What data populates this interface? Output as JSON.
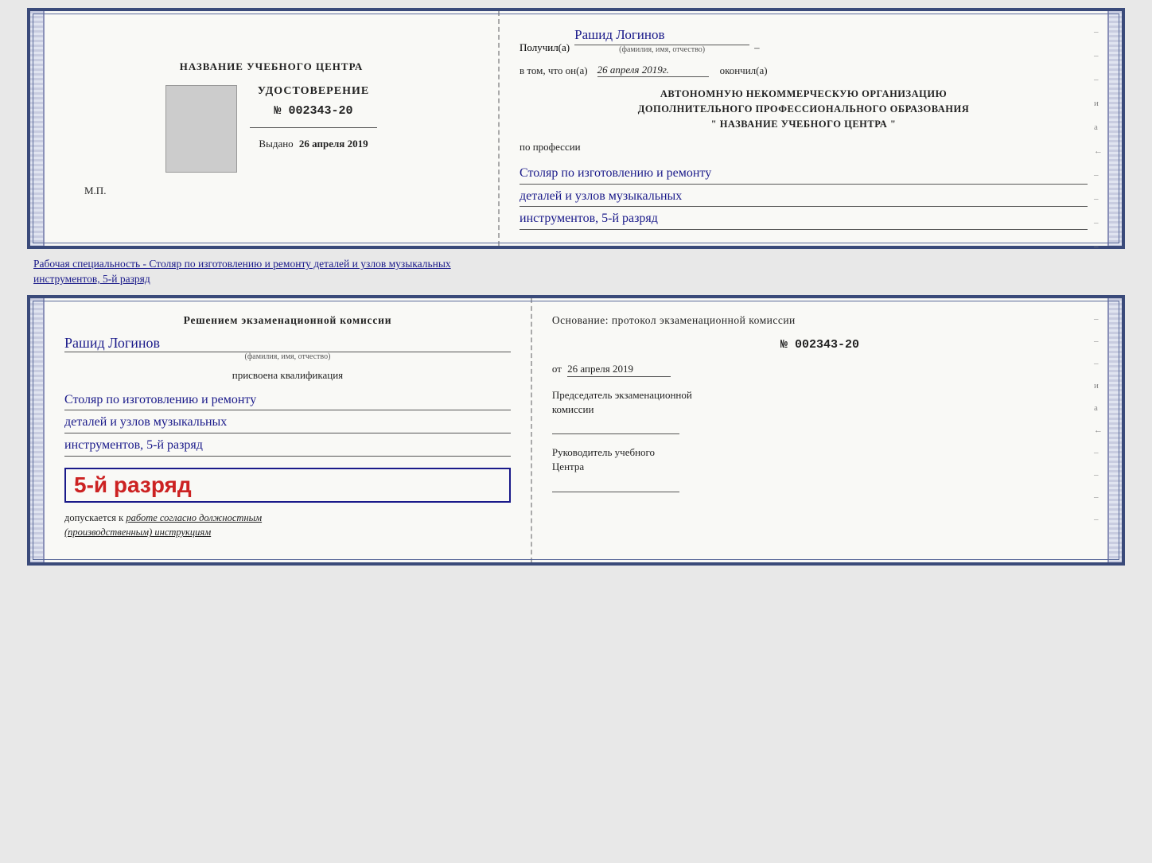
{
  "topCert": {
    "leftSide": {
      "orgNameLabel": "НАЗВАНИЕ УЧЕБНОГО ЦЕНТРА",
      "udostoverenie": "УДОСТОВЕРЕНИЕ",
      "number": "№ 002343-20",
      "issuedLabel": "Выдано",
      "issuedDate": "26 апреля 2019",
      "mpLabel": "М.П."
    },
    "rightSide": {
      "poluchilLabel": "Получил(а)",
      "recipientName": "Рашид Логинов",
      "fioHint": "(фамилия, имя, отчество)",
      "dashSymbol": "–",
      "vtomLabel": "в том, что он(а)",
      "vtomDate": "26 апреля 2019г.",
      "okonchilLabel": "окончил(а)",
      "orgBlock1": "АВТОНОМНУЮ НЕКОММЕРЧЕСКУЮ ОРГАНИЗАЦИЮ",
      "orgBlock2": "ДОПОЛНИТЕЛЬНОГО ПРОФЕССИОНАЛЬНОГО ОБРАЗОВАНИЯ",
      "orgBlock3": "\"   НАЗВАНИЕ УЧЕБНОГО ЦЕНТРА   \"",
      "poProf": "по профессии",
      "prof1": "Столяр по изготовлению и ремонту",
      "prof2": "деталей и узлов музыкальных",
      "prof3": "инструментов, 5-й разряд",
      "rightDashes": [
        "-",
        "-",
        "-",
        "и",
        "а",
        "←",
        "-",
        "-",
        "-",
        "-",
        "-"
      ]
    }
  },
  "middleText": {
    "text1": "Рабочая специальность - Столяр по изготовлению и ремонту деталей и узлов музыкальных",
    "text2": "инструментов, 5-й разряд"
  },
  "bottomCert": {
    "leftSide": {
      "resheniemLabel": "Решением  экзаменационной  комиссии",
      "personName": "Рашид Логинов",
      "fioHint": "(фамилия, имя, отчество)",
      "prisvoeenaLabel": "присвоена квалификация",
      "kvalif1": "Столяр по изготовлению и ремонту",
      "kvalif2": "деталей и узлов музыкальных",
      "kvalif3": "инструментов, 5-й разряд",
      "razryadBig": "5-й разряд",
      "dopuskaetsyaLabel": "допускается к",
      "dopuskItalic": "работе согласно должностным",
      "dopuskItalic2": "(производственным) инструкциям"
    },
    "rightSide": {
      "osnovanieLable": "Основание: протокол экзаменационной  комиссии",
      "protokolNumber": "№  002343-20",
      "otLabel": "от",
      "otDate": "26 апреля 2019",
      "predsedatelLabel": "Председатель экзаменационной",
      "komissiiLabel": "комиссии",
      "rukovoditelLabel": "Руководитель учебного",
      "tsentraLabel": "Центра",
      "rightDashes": [
        "-",
        "-",
        "-",
        "и",
        "а",
        "←",
        "-",
        "-",
        "-",
        "-",
        "-"
      ]
    }
  }
}
